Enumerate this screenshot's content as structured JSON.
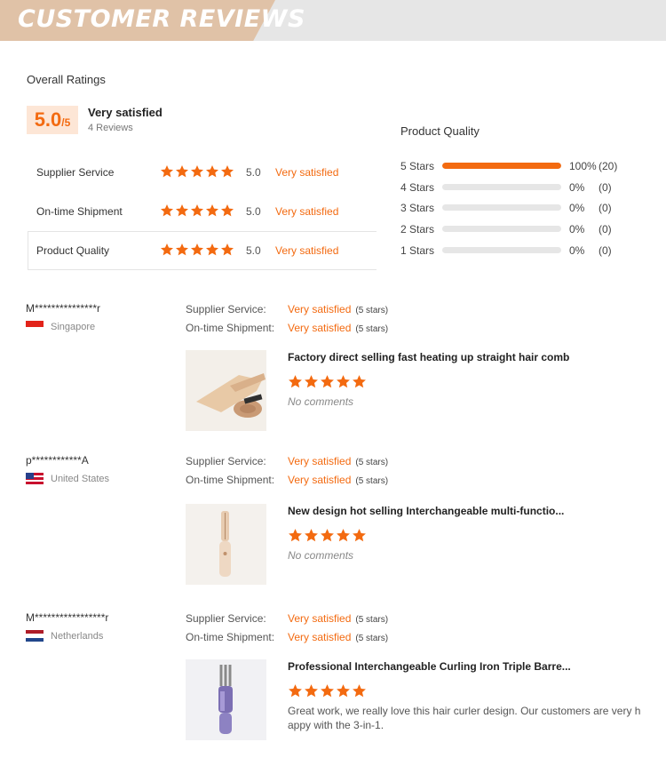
{
  "banner": {
    "title": "CUSTOMER REVIEWS"
  },
  "overall": {
    "title": "Overall Ratings",
    "score": "5.0",
    "out_of": "/5",
    "satisfaction": "Very satisfied",
    "reviews_count": "4 Reviews",
    "rows": [
      {
        "label": "Supplier Service",
        "score": "5.0",
        "stars": 5,
        "satisfaction": "Very satisfied"
      },
      {
        "label": "On-time Shipment",
        "score": "5.0",
        "stars": 5,
        "satisfaction": "Very satisfied"
      },
      {
        "label": "Product Quality",
        "score": "5.0",
        "stars": 5,
        "satisfaction": "Very satisfied"
      }
    ]
  },
  "product_quality": {
    "title": "Product Quality",
    "rows": [
      {
        "label": "5 Stars",
        "percent": "100%",
        "count": "(20)",
        "fill": 1.0
      },
      {
        "label": "4 Stars",
        "percent": "0%",
        "count": "(0)",
        "fill": 0
      },
      {
        "label": "3 Stars",
        "percent": "0%",
        "count": "(0)",
        "fill": 0
      },
      {
        "label": "2 Stars",
        "percent": "0%",
        "count": "(0)",
        "fill": 0
      },
      {
        "label": "1 Stars",
        "percent": "0%",
        "count": "(0)",
        "fill": 0
      }
    ]
  },
  "reviews": [
    {
      "user": "M***************r",
      "country": "Singapore",
      "flag": "singapore-flag-icon",
      "supplier_label": "Supplier Service:",
      "supplier_value": "Very satisfied",
      "supplier_stars": "(5 stars)",
      "shipment_label": "On-time Shipment:",
      "shipment_value": "Very satisfied",
      "shipment_stars": "(5 stars)",
      "product": "Factory direct selling fast heating up straight hair comb",
      "stars": 5,
      "comment": "No comments",
      "product_image": "hair-comb-product-image"
    },
    {
      "user": "p************A",
      "country": "United States",
      "flag": "united-states-flag-icon",
      "supplier_label": "Supplier Service:",
      "supplier_value": "Very satisfied",
      "supplier_stars": "(5 stars)",
      "shipment_label": "On-time Shipment:",
      "shipment_value": "Very satisfied",
      "shipment_stars": "(5 stars)",
      "product": "New design hot selling Interchangeable multi-functio...",
      "stars": 5,
      "comment": "No comments",
      "product_image": "curling-wand-product-image"
    },
    {
      "user": "M*****************r",
      "country": "Netherlands",
      "flag": "netherlands-flag-icon",
      "supplier_label": "Supplier Service:",
      "supplier_value": "Very satisfied",
      "supplier_stars": "(5 stars)",
      "shipment_label": "On-time Shipment:",
      "shipment_value": "Very satisfied",
      "shipment_stars": "(5 stars)",
      "product": "Professional Interchangeable Curling Iron Triple Barre...",
      "stars": 5,
      "comment": "Great work, we really love this hair curler design. Our customers are very h appy with the 3-in-1.",
      "product_image": "triple-barrel-curler-product-image"
    }
  ],
  "colors": {
    "accent": "#f36a10",
    "banner_tan": "#e0c2a7",
    "banner_grey": "#e6e6e6",
    "score_bg": "#fde6d6"
  }
}
